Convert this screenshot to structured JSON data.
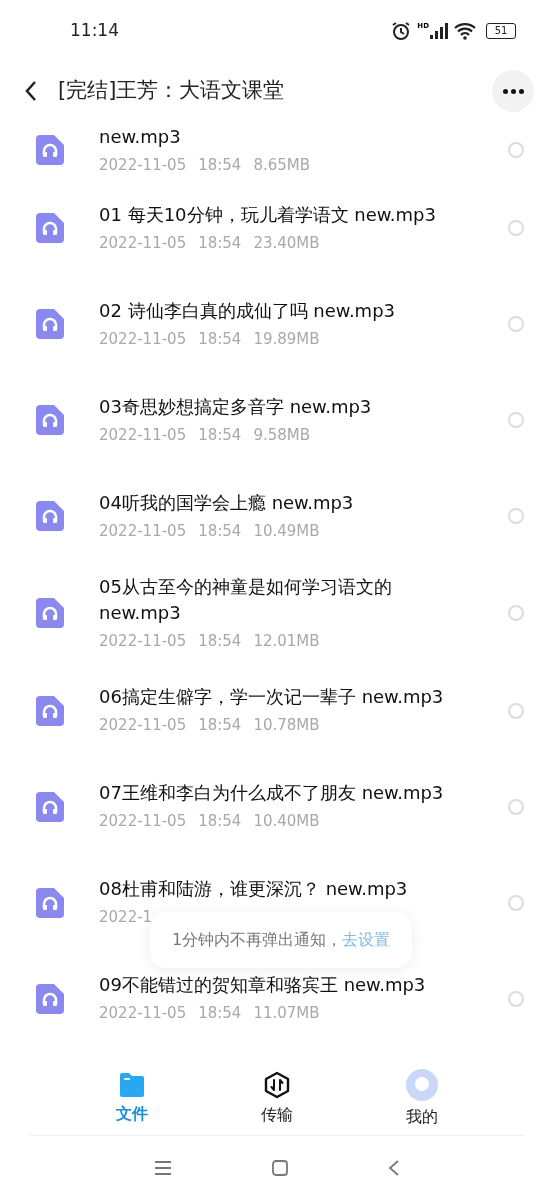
{
  "status_bar": {
    "time": "11:14",
    "battery": "51",
    "network_label": "HD"
  },
  "header": {
    "title": "[完结]王芳：大语文课堂"
  },
  "files": [
    {
      "name": "new.mp3",
      "date": "2022-11-05",
      "time": "18:54",
      "size": "8.65MB",
      "selected": false
    },
    {
      "name": "01 每天10分钟，玩儿着学语文 new.mp3",
      "date": "2022-11-05",
      "time": "18:54",
      "size": "23.40MB",
      "selected": false
    },
    {
      "name": "02 诗仙李白真的成仙了吗 new.mp3",
      "date": "2022-11-05",
      "time": "18:54",
      "size": "19.89MB",
      "selected": false
    },
    {
      "name": "03奇思妙想搞定多音字 new.mp3",
      "date": "2022-11-05",
      "time": "18:54",
      "size": "9.58MB",
      "selected": false
    },
    {
      "name": "04听我的国学会上瘾 new.mp3",
      "date": "2022-11-05",
      "time": "18:54",
      "size": "10.49MB",
      "selected": false
    },
    {
      "name": "05从古至今的神童是如何学习语文的 new.mp3",
      "date": "2022-11-05",
      "time": "18:54",
      "size": "12.01MB",
      "selected": false
    },
    {
      "name": "06搞定生僻字，学一次记一辈子 new.mp3",
      "date": "2022-11-05",
      "time": "18:54",
      "size": "10.78MB",
      "selected": false
    },
    {
      "name": "07王维和李白为什么成不了朋友 new.mp3",
      "date": "2022-11-05",
      "time": "18:54",
      "size": "10.40MB",
      "selected": false
    },
    {
      "name": "08杜甫和陆游，谁更深沉？ new.mp3",
      "date": "2022-1",
      "selected": false
    },
    {
      "name": "09不能错过的贺知章和骆宾王 new.mp3",
      "date": "2022-11-05",
      "time": "18:54",
      "size": "11.07MB",
      "selected": false
    }
  ],
  "toast": {
    "message": "1分钟内不再弹出通知，",
    "link": "去设置"
  },
  "tabs": [
    {
      "label": "文件",
      "kind": "files",
      "selected": true
    },
    {
      "label": "传输",
      "kind": "transfer",
      "selected": false
    },
    {
      "label": "我的",
      "kind": "profile",
      "selected": false
    }
  ]
}
